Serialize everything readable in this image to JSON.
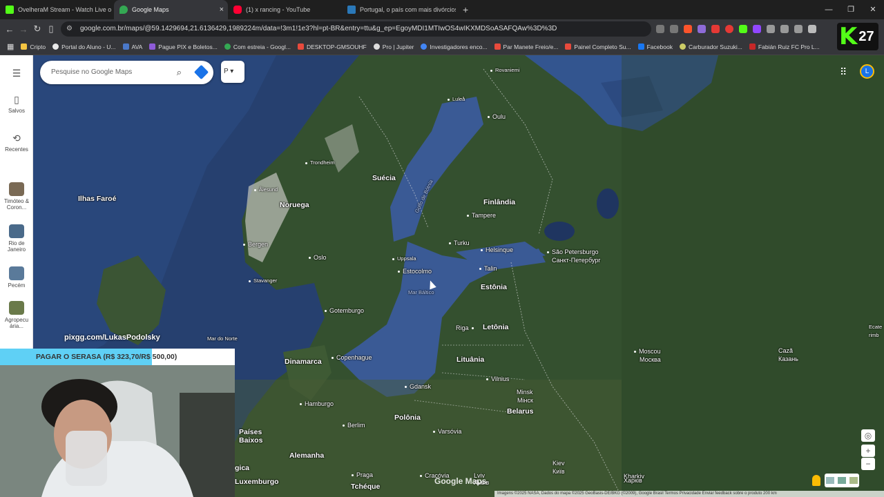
{
  "browser": {
    "tabs": [
      {
        "title": "OvelheraM Stream - Watch Live o",
        "color": "#53fc18"
      },
      {
        "title": "Google Maps",
        "color": "#34a853",
        "active": true
      },
      {
        "title": "(1) x rancing - YouTube",
        "color": "#ff0033"
      },
      {
        "title": "Portugal, o país com mais divórcios d",
        "color": "#2a78b8"
      }
    ],
    "close_glyph": "×",
    "new_tab_glyph": "+",
    "url": "google.com.br/maps/@59.1429694,21.6136429,1989224m/data=!3m1!1e3?hl=pt-BR&entry=ttu&g_ep=EgoyMDI1MTIwOS4wIKXMDSoASAFQAw%3D%3D",
    "bookmarks": [
      {
        "label": "Cripto",
        "color": "#f5c542"
      },
      {
        "label": "Portal do Aluno - U...",
        "color": "#e9e9e9"
      },
      {
        "label": "AVA",
        "color": "#4a78c8"
      },
      {
        "label": "Pague PIX e Boletos...",
        "color": "#8e5bd8"
      },
      {
        "label": "Com estreia - Googl...",
        "color": "#34a853"
      },
      {
        "label": "DESKTOP-GMSOUHF",
        "color": "#e84a3c"
      },
      {
        "label": "Pro | Jupiter",
        "color": "#dddddd"
      },
      {
        "label": "Investigadores enco...",
        "color": "#4285f4"
      },
      {
        "label": "Par Manete Freio/e...",
        "color": "#e84a3c"
      },
      {
        "label": "Painel Completo Su...",
        "color": "#e84a3c"
      },
      {
        "label": "Facebook",
        "color": "#1877f2"
      },
      {
        "label": "Carburador Suzuki...",
        "color": "#cccc66"
      },
      {
        "label": "Fabián Ruiz FC Pro L...",
        "color": "#c62828"
      }
    ],
    "kick_badge": {
      "letter": "K",
      "number": "27"
    }
  },
  "maps": {
    "search_placeholder": "Pesquise no Google Maps",
    "filter_label": "P",
    "avatar_letter": "L",
    "sidebar": [
      {
        "label": "Salvos",
        "icon": "bookmark-icon"
      },
      {
        "label": "Recentes",
        "icon": "history-icon"
      },
      {
        "label": "Timóteo & Coron...",
        "thumb": "#7a6a55"
      },
      {
        "label": "Rio de Janeiro",
        "thumb": "#4a6a8a"
      },
      {
        "label": "Pecém",
        "thumb": "#5a7a9a"
      },
      {
        "label": "Agropecu ária...",
        "thumb": "#6a7a4a"
      }
    ],
    "labels": {
      "rovaniemi": "Rovaniemi",
      "lulea": "Luleå",
      "oulu": "Oulu",
      "trondheim": "Trondheim",
      "suecia": "Suécia",
      "golfo": "Golfo de Bótnia",
      "ilhas_faroe": "Ilhas Faroé",
      "alesund": "Ålesund",
      "noruega": "Noruega",
      "finlandia": "Finlândia",
      "tampere": "Tampere",
      "bergen": "Bergen",
      "turku": "Turku",
      "helsinque": "Helsinque",
      "sao_petersburgo": "São Petersburgo",
      "sao_petersburgo_ru": "Санкт-Петербург",
      "oslo": "Oslo",
      "uppsala": "Uppsala",
      "talin": "Talin",
      "estocolmo": "Estocolmo",
      "stavanger": "Stavanger",
      "estonia": "Estônia",
      "mar_baltico": "Mar Báltico",
      "gotemburgo": "Gotemburgo",
      "riga": "Riga",
      "letonia": "Letônia",
      "mar_do_norte": "Mar do Norte",
      "ecaterimburgo": "Ecate\nrimb",
      "dinamarca": "Dinamarca",
      "copenhague": "Copenhague",
      "lituania": "Lituânia",
      "moscou": "Moscou",
      "moscou_ru": "Москва",
      "caza": "Cazã",
      "caza_ru": "Казань",
      "vilnius": "Vilnius",
      "gdansk": "Gdansk",
      "minsk": "Minsk",
      "minsk_ru": "Мінск",
      "hamburgo": "Hamburgo",
      "belarus": "Belarus",
      "polonia": "Polônia",
      "paises_baixos": "Países\nBaixos",
      "berlim": "Berlim",
      "varsovia": "Varsóvia",
      "alemanha": "Alemanha",
      "kiev": "Kiev",
      "kiev_ua": "Київ",
      "kharkiv": "Kharkiv",
      "kharkiv_ua": "Харків",
      "luxemburgo": "Luxemburgo",
      "praga": "Praga",
      "cracovia": "Cracóvia",
      "lviv": "Lviv",
      "lviv_ua": "Львів",
      "tcheque": "Tchéque",
      "gica": "gica"
    },
    "watermark": "Google Maps",
    "attribution": "Imagens ©2025 NASA, Dados do mapa ©2025 GeoBasis-DE/BKG (©2009), Google    Brasil    Termos    Privacidade    Enviar feedback sobre o produto    200 km",
    "controls": {
      "locate": "◎",
      "zoom_in": "+",
      "zoom_out": "−"
    }
  },
  "stream_overlay": {
    "donate_text": "pixgg.com/LukasPodolsky",
    "goal_text": "PAGAR O SERASA (R$ 323,70/R$ 500,00)",
    "goal_progress": 0.647
  },
  "colors": {
    "water": "#3a5a95",
    "land": "#34502f",
    "land_dark": "#2a4126",
    "snow": "#c9cbc7"
  }
}
